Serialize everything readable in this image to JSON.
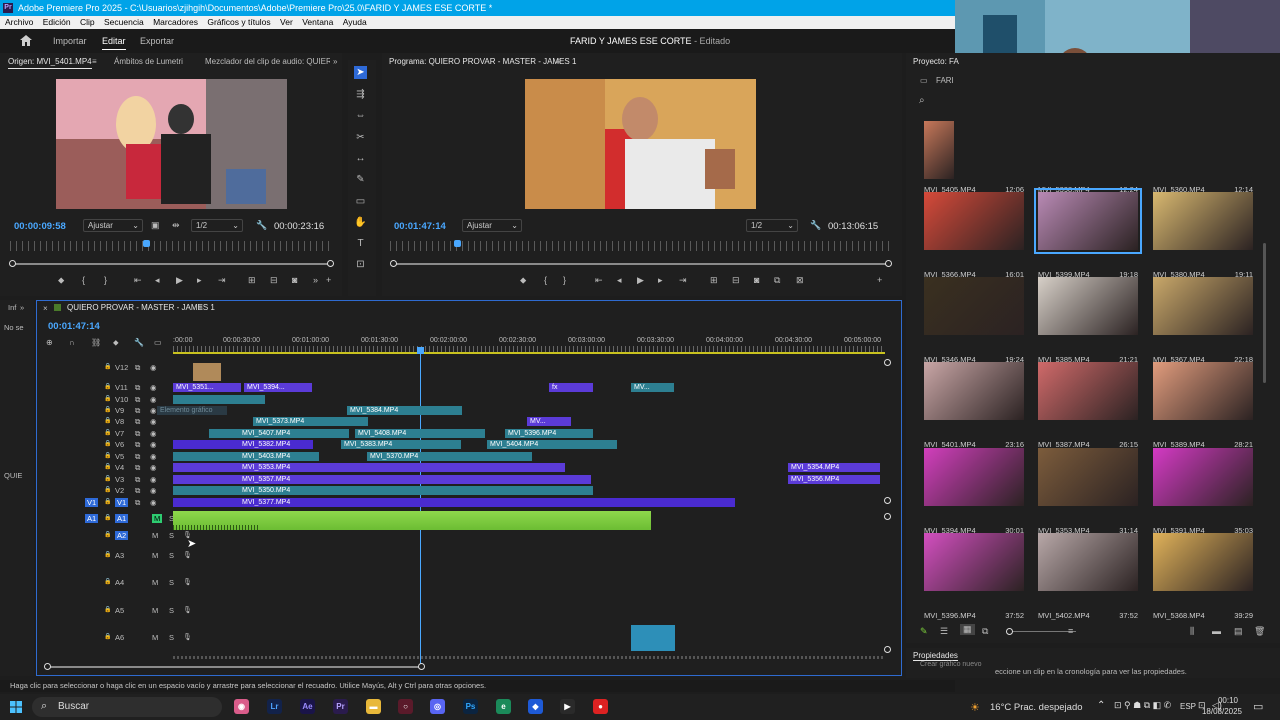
{
  "window": {
    "title": "Adobe Premiere Pro 2025 - C:\\Usuarios\\zjihgih\\Documentos\\Adobe\\Premiere Pro\\25.0\\FARID Y JAMES ESE CORTE *",
    "logo": "Pr"
  },
  "menu": [
    "Archivo",
    "Edición",
    "Clip",
    "Secuencia",
    "Marcadores",
    "Gráficos y títulos",
    "Ver",
    "Ventana",
    "Ayuda"
  ],
  "appbar": {
    "tabs": [
      "Importar",
      "Editar",
      "Exportar"
    ],
    "active_tab": "Editar",
    "project_title": "FARID Y JAMES ESE CORTE",
    "project_status": "- Editado"
  },
  "source": {
    "tabs": [
      "Origen: MVI_5401.MP4",
      "Ámbitos de Lumetri",
      "Mezclador del clip de audio: QUIERO I"
    ],
    "timecode": "00:00:09:58",
    "fit": "Ajustar",
    "resolution": "1/2",
    "duration": "00:00:23:16"
  },
  "program": {
    "title": "Programa: QUIERO PROVAR - MASTER - JAMES 1",
    "timecode": "00:01:47:14",
    "fit": "Ajustar",
    "resolution": "1/2",
    "duration": "00:13:06:15"
  },
  "timeline": {
    "sequence": "QUIERO PROVAR - MASTER - JAMES 1",
    "timecode": "00:01:47:14",
    "side_labels": [
      "Inf",
      "No se",
      "QUIE"
    ],
    "ruler": [
      ":00:00",
      "00:00:30:00",
      "00:01:00:00",
      "00:01:30:00",
      "00:02:00:00",
      "00:02:30:00",
      "00:03:00:00",
      "00:03:30:00",
      "00:04:00:00",
      "00:04:30:00",
      "00:05:00:00"
    ],
    "video_tracks": [
      "V12",
      "V11",
      "V10",
      "V9",
      "V8",
      "V7",
      "V6",
      "V5",
      "V4",
      "V3",
      "V2",
      "V1"
    ],
    "audio_tracks": [
      "A1",
      "A2",
      "A3",
      "A4",
      "A5",
      "A6"
    ],
    "clips": [
      "MVI_5351...",
      "MVI_5394...",
      "MV...",
      "MVI_5384.MP4",
      "MVI_5373.MP4",
      "MV...",
      "MVI_5407.MP4",
      "MVI_5408.MP4",
      "MVI_5396.MP4",
      "MVI_5382.MP4",
      "MVI_5383.MP4",
      "MVI_5404.MP4",
      "MVI_5403.MP4",
      "MVI_5370.MP4",
      "MVI_5353.MP4",
      "MVI_5354.MP4",
      "MVI_5357.MP4",
      "MVI_5356.MP4",
      "MVI_5350.MP4",
      "MVI_5377.MP4",
      "Elemento gráfico"
    ],
    "fx": "fx"
  },
  "project": {
    "title": "Proyecto: FA",
    "bin": "FARI",
    "items": [
      {
        "name": "MVI_5405.MP4",
        "dur": "12:06"
      },
      {
        "name": "MVI_5398.MP4",
        "dur": "12:24"
      },
      {
        "name": "MVI_5360.MP4",
        "dur": "12:14"
      },
      {
        "name": "MVI_5366.MP4",
        "dur": "16:01"
      },
      {
        "name": "MVI_5399.MP4",
        "dur": "19:18"
      },
      {
        "name": "MVI_5380.MP4",
        "dur": "19:11"
      },
      {
        "name": "MVI_5346.MP4",
        "dur": "19:24"
      },
      {
        "name": "MVI_5385.MP4",
        "dur": "21:21"
      },
      {
        "name": "MVI_5367.MP4",
        "dur": "22:18"
      },
      {
        "name": "MVI_5401.MP4",
        "dur": "23:16"
      },
      {
        "name": "MVI_5387.MP4",
        "dur": "26:15"
      },
      {
        "name": "MVI_5389.MP4",
        "dur": "28:21"
      },
      {
        "name": "MVI_5394.MP4",
        "dur": "30:01"
      },
      {
        "name": "MVI_5353.MP4",
        "dur": "31:14"
      },
      {
        "name": "MVI_5391.MP4",
        "dur": "35:03"
      },
      {
        "name": "MVI_5396.MP4",
        "dur": "37:52"
      },
      {
        "name": "MVI_5402.MP4",
        "dur": "37:52"
      },
      {
        "name": "MVI_5368.MP4",
        "dur": "39:29"
      }
    ]
  },
  "properties": {
    "title": "Propiedades",
    "graphic_button": "Crear gráfico nuevo",
    "hint": "eccione un clip en la cronología para ver las propiedades."
  },
  "status_bar": "Haga clic para seleccionar o haga clic en un espacio vacío y arrastre para seleccionar el recuadro. Utilice Mayús, Alt y Ctrl para otras opciones.",
  "taskbar": {
    "search": "Buscar",
    "weather": "16°C  Prac. despejado",
    "lang": "ESP",
    "time": "00:10",
    "date": "18/08/2025"
  },
  "colors": {
    "accent": "#4aa8ff",
    "titlebar": "#00a3e8",
    "video_clip": "#5b3bd8",
    "audio_clip": "#7ccf3c",
    "teal_clip": "#2d7f91"
  }
}
